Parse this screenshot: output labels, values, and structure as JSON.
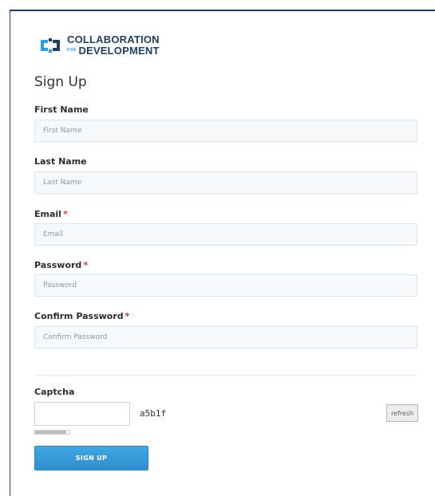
{
  "brand": {
    "line1": "COLLABORATION",
    "for": "FOR",
    "line2": "DEVELOPMENT"
  },
  "form": {
    "heading": "Sign Up",
    "first_name": {
      "label": "First Name",
      "placeholder": "First Name",
      "value": ""
    },
    "last_name": {
      "label": "Last Name",
      "placeholder": "Last Name",
      "value": ""
    },
    "email": {
      "label": "Email",
      "required_mark": "*",
      "placeholder": "Email",
      "value": ""
    },
    "password": {
      "label": "Password",
      "required_mark": "*",
      "placeholder": "Password",
      "value": ""
    },
    "confirm_password": {
      "label": "Confirm Password",
      "required_mark": "*",
      "placeholder": "Confirm Password",
      "value": ""
    },
    "captcha": {
      "label": "Captcha",
      "code": "a5b1f",
      "refresh_label": "refresh",
      "value": "",
      "progress_fraction": 0.9
    },
    "submit_label": "SIGN UP"
  },
  "colors": {
    "brand_navy": "#1d3f66",
    "brand_blue": "#2aa0dc",
    "required": "#d9392b",
    "button": "#3399dd"
  },
  "icons": {
    "logo": "collaboration-logo-icon"
  }
}
